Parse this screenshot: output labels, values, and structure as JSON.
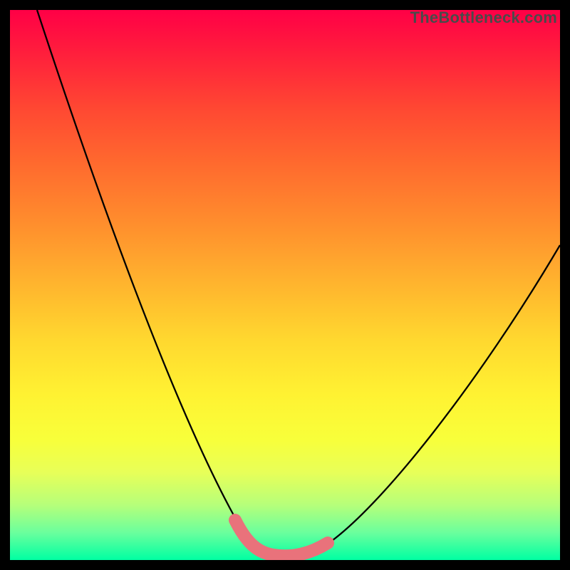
{
  "watermark": "TheBottleneck.com",
  "chart_data": {
    "type": "line",
    "title": "",
    "xlabel": "",
    "ylabel": "",
    "xlim": [
      0,
      100
    ],
    "ylim": [
      0,
      100
    ],
    "series": [
      {
        "name": "bottleneck-curve",
        "x": [
          5,
          10,
          15,
          20,
          25,
          30,
          35,
          40,
          43,
          46,
          50,
          53,
          57,
          62,
          68,
          74,
          80,
          86,
          92,
          98,
          100
        ],
        "values": [
          100,
          88,
          76,
          63,
          50,
          37,
          24,
          12,
          4,
          1,
          0,
          0,
          1,
          5,
          12,
          20,
          29,
          38,
          47,
          55,
          58
        ]
      },
      {
        "name": "optimal-band",
        "x": [
          43,
          46,
          50,
          53,
          57
        ],
        "values": [
          4,
          1,
          0,
          0,
          1
        ]
      }
    ],
    "annotations": []
  }
}
